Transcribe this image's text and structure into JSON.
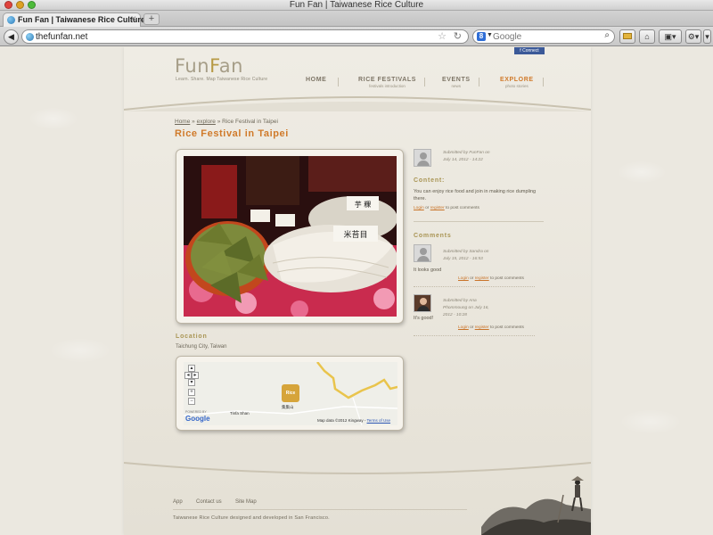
{
  "window": {
    "title": "Fun Fan | Taiwanese Rice Culture"
  },
  "tab": {
    "label": "Fun Fan | Taiwanese Rice Culture",
    "close": "×",
    "new_tab": "+"
  },
  "toolbar": {
    "url": "thefunfan.net",
    "search_placeholder": "Google",
    "back": "◀"
  },
  "facebook": {
    "label": "Connect"
  },
  "site": {
    "logo_text_1": "Fun",
    "logo_text_2": "F",
    "logo_text_3": "an",
    "tagline": "Learn. Share. Map Taiwanese Rice Culture"
  },
  "nav": [
    {
      "label": "HOME",
      "sub": ""
    },
    {
      "label": "RICE FESTIVALS",
      "sub": "festivals introduction"
    },
    {
      "label": "EVENTS",
      "sub": "news"
    },
    {
      "label": "EXPLORE",
      "sub": "photo stories"
    }
  ],
  "breadcrumb": {
    "home": "Home",
    "sep1": "»",
    "explore": "explore",
    "sep2": "»",
    "current": "Rice Festival in Taipei"
  },
  "page_title": "Rice Festival in Taipei",
  "photo": {
    "sign_1": "米苔目",
    "sign_2": "芋 粿"
  },
  "location": {
    "label": "Location",
    "text": "Taichung City, Taiwan"
  },
  "map": {
    "powered": "POWERED BY",
    "google": "Google",
    "poi_1": "Tinfa Shan",
    "poi_2": "集集山",
    "credit": "Map data ©2012 Kingway",
    "terms": "Terms of Use",
    "marker": "Rice"
  },
  "post": {
    "submitted": "Submitted by FunFan on",
    "date": "July 14, 2012 - 14:22",
    "content_label": "Content:",
    "content_text": "You can enjoy rice food and join in making rice dumpling there.",
    "login": "Login",
    "or": "or",
    "register": "register",
    "to_post": "to post comments"
  },
  "comments": {
    "label": "Comments",
    "items": [
      {
        "submitted": "Submitted by Sandra on",
        "date": "July 15, 2012 - 16:53",
        "text": "It looks good",
        "login": "Login",
        "or": "or",
        "register": "register",
        "to_post": "to post comments"
      },
      {
        "submitted": "Submitted by Ana",
        "submitted_2": "Phommoung on July 16,",
        "date": "2012 - 10:28",
        "text": "It's good!",
        "login": "Login",
        "or": "or",
        "register": "register",
        "to_post": "to post comments"
      }
    ]
  },
  "footer": {
    "links": [
      "App",
      "Contact us",
      "Site Map"
    ],
    "credit": "Taiwanese Rice Culture designed and developed in San Francisco."
  },
  "colors": {
    "accent": "#d07a2a",
    "olive": "#a99554",
    "text": "#6f695b",
    "page_bg": "#ebe8e0"
  }
}
